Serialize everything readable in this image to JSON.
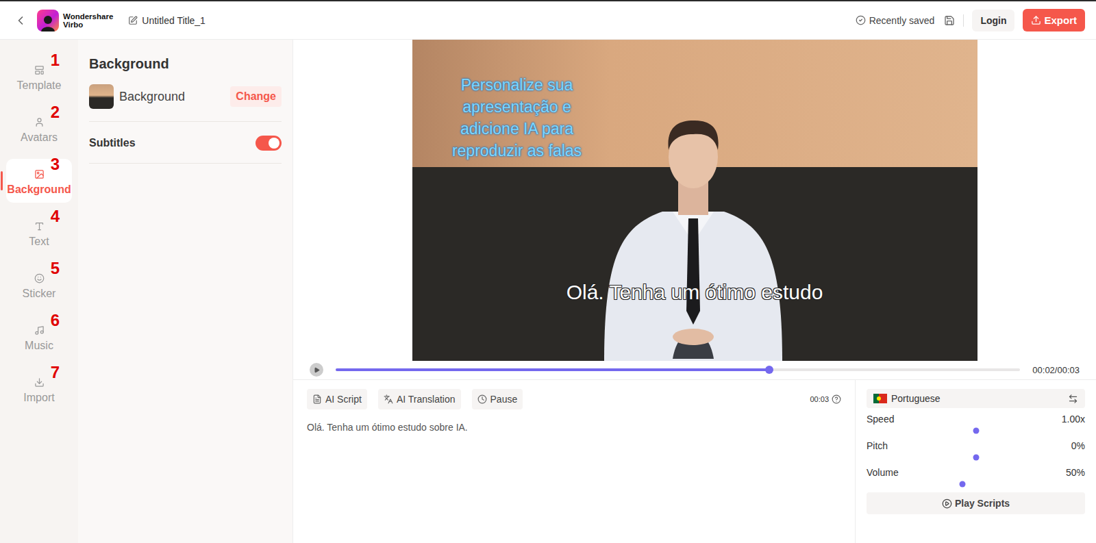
{
  "header": {
    "brand_top": "Wondershare",
    "brand_bottom": "Virbo",
    "title": "Untitled Title_1",
    "status": "Recently saved",
    "login": "Login",
    "export": "Export"
  },
  "nav": [
    {
      "label": "Template",
      "number": "1",
      "selected": false
    },
    {
      "label": "Avatars",
      "number": "2",
      "selected": false
    },
    {
      "label": "Background",
      "number": "3",
      "selected": true
    },
    {
      "label": "Text",
      "number": "4",
      "selected": false
    },
    {
      "label": "Sticker",
      "number": "5",
      "selected": false
    },
    {
      "label": "Music",
      "number": "6",
      "selected": false
    },
    {
      "label": "Import",
      "number": "7",
      "selected": false
    }
  ],
  "panel": {
    "title": "Background",
    "background_label": "Background",
    "change": "Change",
    "subtitles": {
      "label": "Subtitles",
      "on": true
    }
  },
  "canvas": {
    "headline": "Personalize sua apresentação e adicione IA para reproduzir as falas",
    "subtitle": "Olá. Tenha um ótimo estudo"
  },
  "player": {
    "level": 0.633,
    "time": "00:02/00:03"
  },
  "script": {
    "tools": [
      "AI Script",
      "AI Translation",
      "Pause"
    ],
    "duration": "00:03",
    "text": "Olá. Tenha um ótimo estudo sobre IA."
  },
  "voice": {
    "language": "Portuguese",
    "sliders": [
      {
        "label": "Speed",
        "reading": "1.00x",
        "level": 0.5
      },
      {
        "label": "Pitch",
        "reading": "0%",
        "level": 0.5
      },
      {
        "label": "Volume",
        "reading": "50%",
        "level": 0.44
      }
    ],
    "play": "Play Scripts"
  }
}
